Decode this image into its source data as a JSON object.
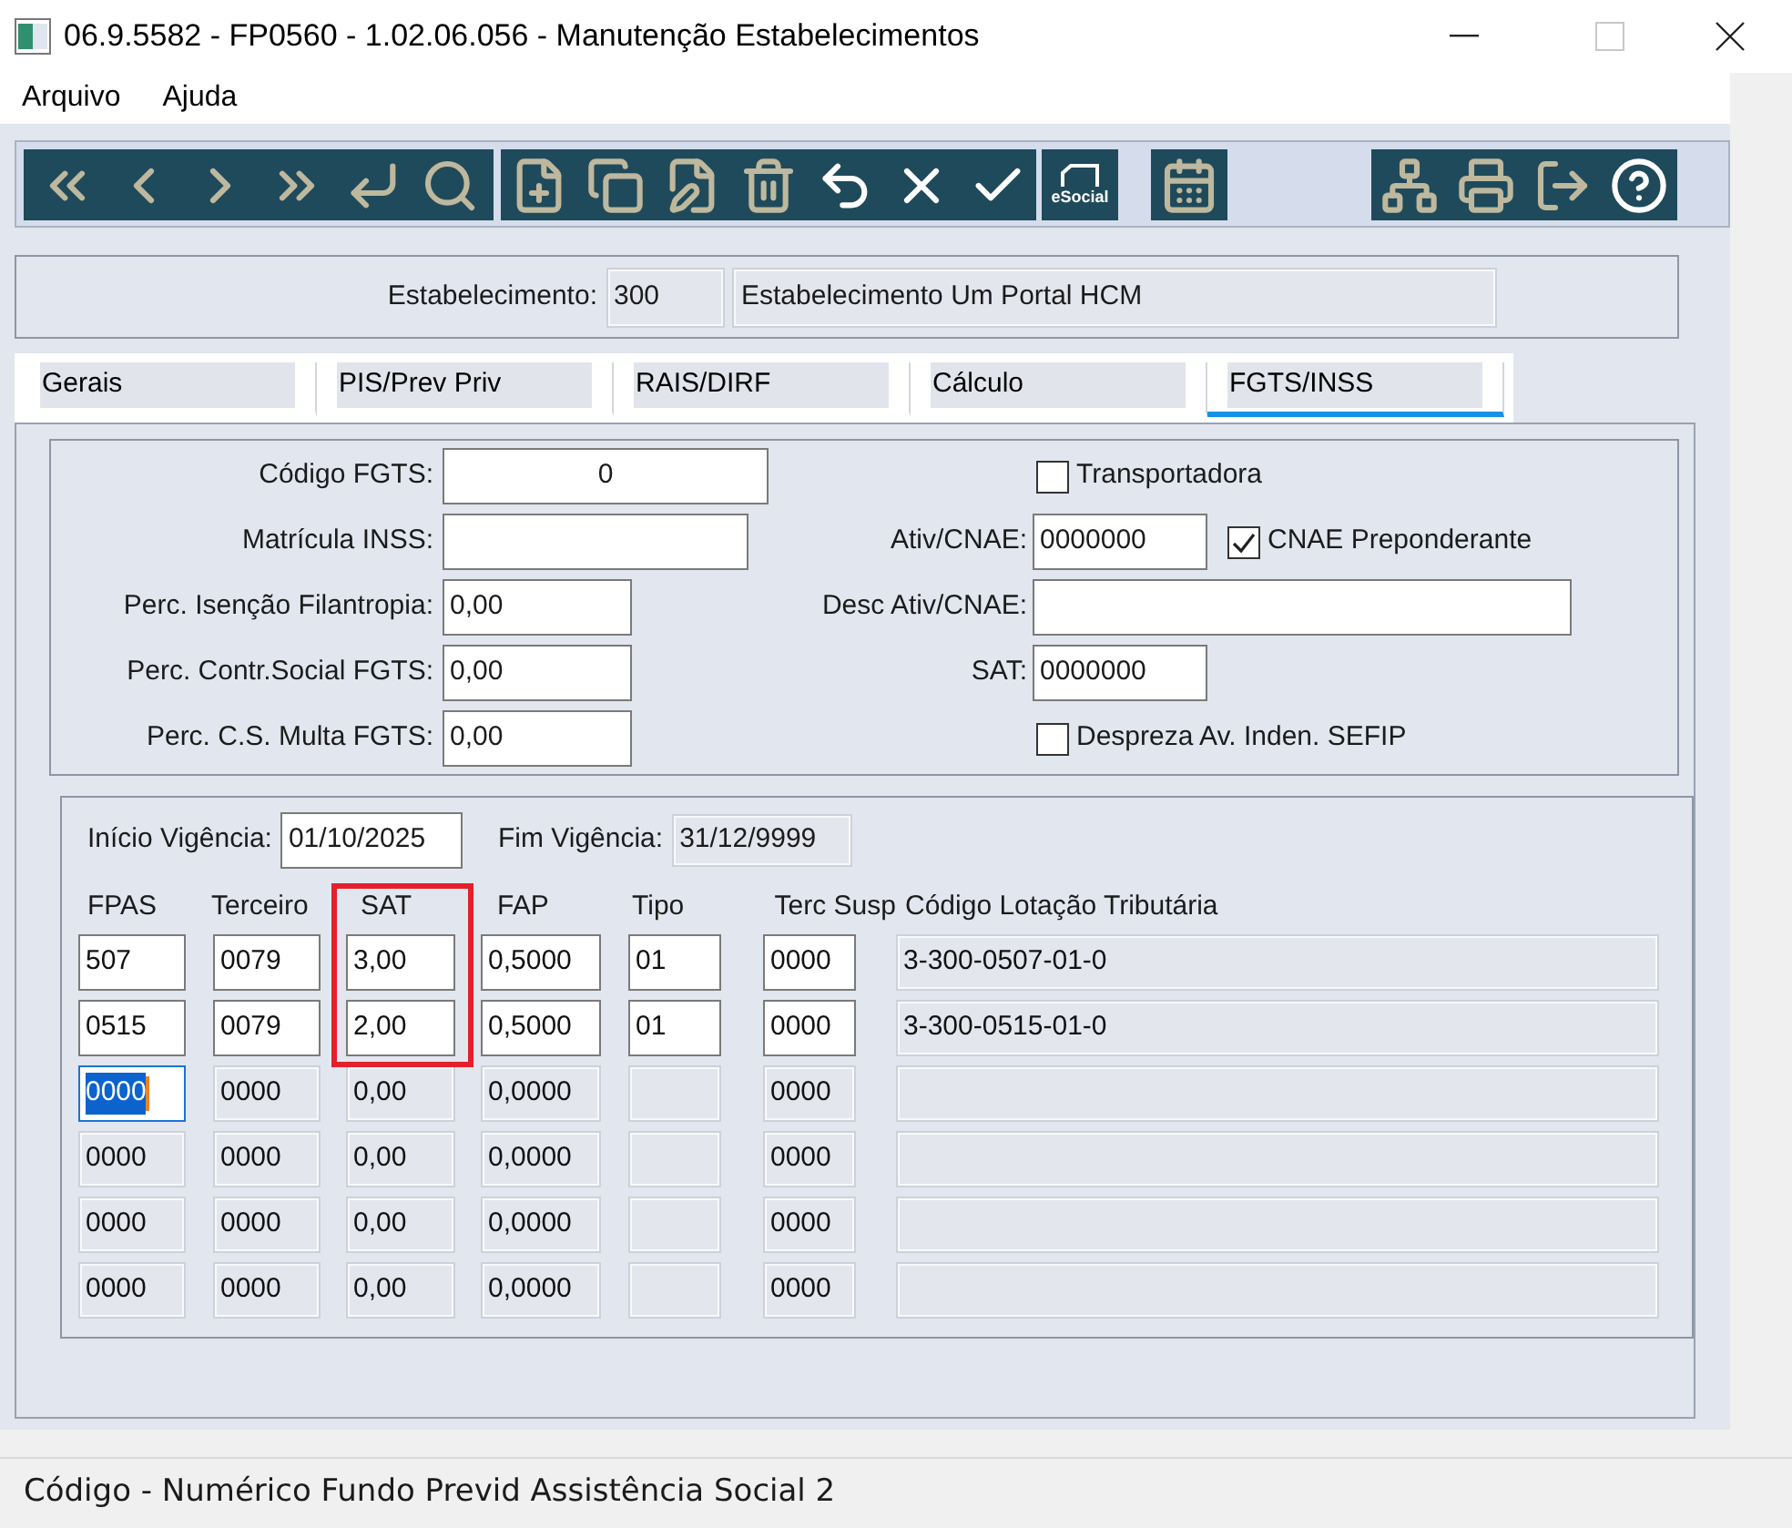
{
  "window": {
    "title": "06.9.5582 - FP0560 - 1.02.06.056 - Manutenção Estabelecimentos",
    "controls": [
      {
        "kind": "minimize",
        "disabled": false
      },
      {
        "kind": "maximize",
        "disabled": true
      },
      {
        "kind": "close",
        "disabled": false
      }
    ]
  },
  "menu": [
    "Arquivo",
    "Ajuda"
  ],
  "toolbar": [
    {
      "buttons": [
        {
          "kind": "first",
          "disabled": true
        },
        {
          "kind": "previous",
          "disabled": true
        },
        {
          "kind": "next",
          "disabled": true
        },
        {
          "kind": "last",
          "disabled": true
        },
        {
          "kind": "enter",
          "disabled": true
        },
        {
          "kind": "search",
          "disabled": true
        }
      ]
    },
    {
      "buttons": [
        {
          "kind": "new",
          "disabled": true
        },
        {
          "kind": "copy",
          "disabled": true
        },
        {
          "kind": "edit",
          "disabled": true
        },
        {
          "kind": "delete",
          "disabled": true
        },
        {
          "kind": "undo",
          "disabled": false
        },
        {
          "kind": "cancel",
          "disabled": false
        },
        {
          "kind": "confirm",
          "disabled": false
        }
      ]
    },
    {
      "buttons": [
        {
          "kind": "esocial",
          "label": "eSocial",
          "disabled": false
        }
      ]
    },
    {
      "buttons": [
        {
          "kind": "calendar",
          "disabled": true
        }
      ]
    },
    {
      "buttons": [
        {
          "kind": "structure",
          "disabled": true
        },
        {
          "kind": "print",
          "disabled": true
        },
        {
          "kind": "exit",
          "disabled": true
        },
        {
          "kind": "help",
          "disabled": false
        }
      ]
    }
  ],
  "establishment": {
    "label": "Estabelecimento:",
    "code": "300",
    "name": "Estabelecimento Um Portal HCM"
  },
  "tabs": [
    {
      "label": "Gerais",
      "selected": false
    },
    {
      "label": "PIS/Prev Priv",
      "selected": false
    },
    {
      "label": "RAIS/DIRF",
      "selected": false
    },
    {
      "label": "Cálculo",
      "selected": false
    },
    {
      "label": "FGTS/INSS",
      "selected": true
    }
  ],
  "fgts": {
    "left": [
      {
        "kind": "code",
        "label": "Código FGTS:",
        "value": "0"
      },
      {
        "kind": "registration",
        "label": "Matrícula INSS:"
      },
      {
        "kind": "percent",
        "label": "Perc. Isenção Filantropia:",
        "value": "0,00"
      },
      {
        "kind": "percent",
        "label": "Perc. Contr.Social FGTS:",
        "value": "0,00"
      },
      {
        "kind": "percent",
        "label": "Perc. C.S. Multa FGTS:",
        "value": "0,00"
      }
    ],
    "right": [
      {
        "kind": "checkbox",
        "label": "Transportadora",
        "checked": false
      },
      {
        "kind": "field",
        "label": "Ativ/CNAE:",
        "value": "0000000",
        "checkbox": {
          "label": "CNAE Preponderante",
          "checked": true
        }
      },
      {
        "kind": "wide",
        "label": "Desc Ativ/CNAE:"
      },
      {
        "kind": "field",
        "label": "SAT:",
        "value": "0000000"
      },
      {
        "kind": "checkbox",
        "label": "Despreza Av. Inden. SEFIP",
        "checked": false
      }
    ]
  },
  "vigencia": {
    "start_label": "Início Vigência:",
    "start_value": "01/10/2025",
    "end_label": "Fim Vigência:",
    "end_value": "31/12/9999"
  },
  "table": {
    "columns": [
      {
        "label": "FPAS",
        "highlighted": false
      },
      {
        "label": "Terceiro",
        "highlighted": false
      },
      {
        "label": "SAT",
        "highlighted": true
      },
      {
        "label": "FAP",
        "highlighted": false
      },
      {
        "label": "Tipo",
        "highlighted": false
      },
      {
        "label": "Terc Susp",
        "highlighted": false
      },
      {
        "label": "Código Lotação Tributária",
        "highlighted": false
      }
    ],
    "rows": [
      {
        "highlighted": true,
        "cells": [
          {
            "kind": "input",
            "text": "507"
          },
          {
            "kind": "input",
            "text": "0079"
          },
          {
            "kind": "input",
            "text": "3,00"
          },
          {
            "kind": "input",
            "text": "0,5000"
          },
          {
            "kind": "input",
            "text": "01"
          },
          {
            "kind": "input",
            "text": "0000"
          },
          {
            "kind": "readonly",
            "text": "3-300-0507-01-0"
          }
        ]
      },
      {
        "highlighted": true,
        "cells": [
          {
            "kind": "input",
            "text": "0515"
          },
          {
            "kind": "input",
            "text": "0079"
          },
          {
            "kind": "input",
            "text": "2,00"
          },
          {
            "kind": "input",
            "text": "0,5000"
          },
          {
            "kind": "input",
            "text": "01"
          },
          {
            "kind": "input",
            "text": "0000"
          },
          {
            "kind": "readonly",
            "text": "3-300-0515-01-0"
          }
        ]
      },
      {
        "highlighted": false,
        "cells": [
          {
            "kind": "focused",
            "text": "0000"
          },
          {
            "kind": "readonly",
            "text": "0000"
          },
          {
            "kind": "readonly",
            "text": "0,00"
          },
          {
            "kind": "readonly",
            "text": "0,0000"
          },
          {
            "kind": "readonly"
          },
          {
            "kind": "readonly",
            "text": "0000"
          },
          {
            "kind": "readonly"
          }
        ]
      },
      {
        "highlighted": false,
        "cells": [
          {
            "kind": "readonly",
            "text": "0000"
          },
          {
            "kind": "readonly",
            "text": "0000"
          },
          {
            "kind": "readonly",
            "text": "0,00"
          },
          {
            "kind": "readonly",
            "text": "0,0000"
          },
          {
            "kind": "readonly"
          },
          {
            "kind": "readonly",
            "text": "0000"
          },
          {
            "kind": "readonly"
          }
        ]
      },
      {
        "highlighted": false,
        "cells": [
          {
            "kind": "readonly",
            "text": "0000"
          },
          {
            "kind": "readonly",
            "text": "0000"
          },
          {
            "kind": "readonly",
            "text": "0,00"
          },
          {
            "kind": "readonly",
            "text": "0,0000"
          },
          {
            "kind": "readonly"
          },
          {
            "kind": "readonly",
            "text": "0000"
          },
          {
            "kind": "readonly"
          }
        ]
      },
      {
        "highlighted": false,
        "cells": [
          {
            "kind": "readonly",
            "text": "0000"
          },
          {
            "kind": "readonly",
            "text": "0000"
          },
          {
            "kind": "readonly",
            "text": "0,00"
          },
          {
            "kind": "readonly",
            "text": "0,0000"
          },
          {
            "kind": "readonly"
          },
          {
            "kind": "readonly",
            "text": "0000"
          },
          {
            "kind": "readonly"
          }
        ]
      }
    ]
  },
  "status_bar": "Código - Numérico Fundo Previd Assistência Social 2"
}
